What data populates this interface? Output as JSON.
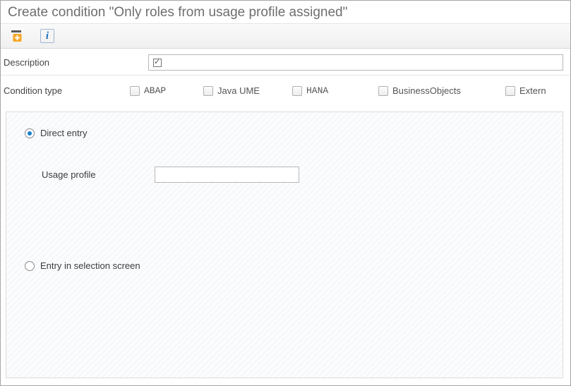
{
  "title": "Create condition \"Only roles from usage profile assigned\"",
  "toolbar": {
    "add_icon": "add-rule-icon",
    "info_icon": "info-icon"
  },
  "description": {
    "label": "Description",
    "checked": true,
    "value": ""
  },
  "condition_type": {
    "label": "Condition type",
    "options": [
      {
        "key": "abap",
        "label": "ABAP",
        "mono": true,
        "checked": false
      },
      {
        "key": "java_ume",
        "label": "Java UME",
        "mono": false,
        "checked": false
      },
      {
        "key": "hana",
        "label": "HANA",
        "mono": true,
        "checked": false
      },
      {
        "key": "business_objects",
        "label": "BusinessObjects",
        "mono": false,
        "checked": false
      },
      {
        "key": "extern",
        "label": "Extern",
        "mono": false,
        "checked": false
      }
    ]
  },
  "entry_mode": {
    "direct": {
      "label": "Direct entry",
      "selected": true
    },
    "selection": {
      "label": "Entry in selection screen",
      "selected": false
    }
  },
  "usage_profile": {
    "label": "Usage profile",
    "value": ""
  },
  "checkbox_layout_widths": [
    104,
    126,
    122,
    180,
    80
  ]
}
